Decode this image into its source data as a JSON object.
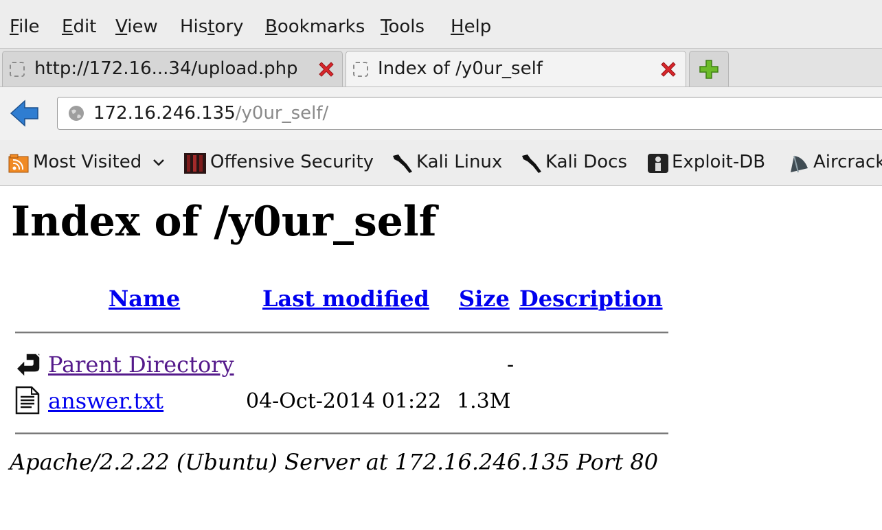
{
  "menu": {
    "items": [
      {
        "first": "F",
        "rest": "ile"
      },
      {
        "first": "E",
        "rest": "dit"
      },
      {
        "first": "V",
        "rest": "iew"
      },
      {
        "first": "His",
        "mid": "t",
        "rest": "ory"
      },
      {
        "first": "B",
        "rest": "ookmarks"
      },
      {
        "first": "T",
        "rest": "ools"
      },
      {
        "first": "H",
        "rest": "elp"
      }
    ]
  },
  "tabs": [
    {
      "title": "http://172.16...34/upload.php",
      "active": false
    },
    {
      "title": "Index of /y0ur_self",
      "active": true
    }
  ],
  "urlbar": {
    "host": "172.16.246.135",
    "path": "/y0ur_self/"
  },
  "bookmarks": [
    {
      "label": "Most Visited",
      "icon": "rss-folder-icon"
    },
    {
      "label": "Offensive Security",
      "icon": "offsec-icon"
    },
    {
      "label": "Kali Linux",
      "icon": "kali-dragon-icon"
    },
    {
      "label": "Kali Docs",
      "icon": "kali-dragon-icon"
    },
    {
      "label": "Exploit-DB",
      "icon": "exploitdb-icon"
    },
    {
      "label": "Aircrack",
      "icon": "aircrack-icon"
    }
  ],
  "page": {
    "title": "Index of /y0ur_self",
    "columns": {
      "name": "Name",
      "modified": "Last modified",
      "size": "Size",
      "description": "Description"
    },
    "rows": [
      {
        "name": "Parent Directory",
        "modified": "",
        "size": "-",
        "icon": "back-arrow-icon",
        "visited": true
      },
      {
        "name": "answer.txt",
        "modified": "04-Oct-2014 01:22",
        "size": "1.3M",
        "icon": "text-file-icon",
        "visited": false
      }
    ],
    "address": "Apache/2.2.22 (Ubuntu) Server at 172.16.246.135 Port 80"
  },
  "colors": {
    "link": "#0000ee",
    "visited": "#551a8b",
    "close_red": "#d8262b",
    "newtab_green": "#6cbb2a",
    "back_blue": "#2f7dd1"
  }
}
